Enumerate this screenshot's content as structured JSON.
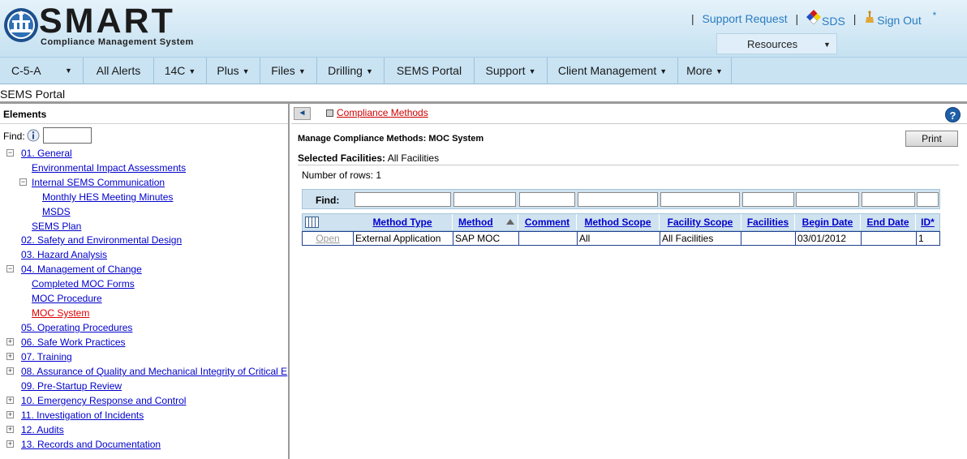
{
  "header": {
    "logo_word": "SMART",
    "logo_subtitle": "Compliance Management System",
    "top_links": {
      "sep": "|",
      "support_request": "Support Request",
      "sds": "SDS",
      "sign_out": "Sign Out",
      "star": "*"
    },
    "resources": {
      "label": "Resources",
      "arrow": "▼"
    }
  },
  "nav": {
    "items": [
      {
        "label": "C-5-A",
        "arrow": "▼"
      },
      {
        "label": "All Alerts"
      },
      {
        "label": "14C",
        "arrow": "▼"
      },
      {
        "label": "Plus",
        "arrow": "▼"
      },
      {
        "label": "Files",
        "arrow": "▼"
      },
      {
        "label": "Drilling",
        "arrow": "▼"
      },
      {
        "label": "SEMS Portal"
      },
      {
        "label": "Support",
        "arrow": "▼"
      },
      {
        "label": "Client Management",
        "arrow": "▼"
      },
      {
        "label": "More",
        "arrow": "▼"
      }
    ]
  },
  "breadcrumb": "SEMS Portal",
  "left_pane": {
    "title": "Elements",
    "find_label": "Find:",
    "find_value": "",
    "toggle_collapse": "−",
    "toggle_expand": "+",
    "tree": [
      {
        "label": "01. General",
        "expanded": true
      },
      {
        "label": "Environmental Impact Assessments"
      },
      {
        "label": "Internal SEMS Communication",
        "expanded": true
      },
      {
        "label": "Monthly HES Meeting Minutes"
      },
      {
        "label": "MSDS"
      },
      {
        "label": "SEMS Plan"
      },
      {
        "label": "02. Safety and Environmental Design"
      },
      {
        "label": "03. Hazard Analysis"
      },
      {
        "label": "04. Management of Change",
        "expanded": true
      },
      {
        "label": "Completed MOC Forms"
      },
      {
        "label": "MOC Procedure"
      },
      {
        "label": "MOC System",
        "selected": true
      },
      {
        "label": "05. Operating Procedures"
      },
      {
        "label": "06. Safe Work Practices"
      },
      {
        "label": "07. Training"
      },
      {
        "label": "08. Assurance of Quality and Mechanical Integrity of Critical E"
      },
      {
        "label": "09. Pre-Startup Review"
      },
      {
        "label": "10. Emergency Response and Control"
      },
      {
        "label": "11. Investigation of Incidents"
      },
      {
        "label": "12. Audits"
      },
      {
        "label": "13. Records and Documentation"
      }
    ]
  },
  "right_pane": {
    "back_icon": "◄",
    "title": "Compliance Methods",
    "help_icon": "?",
    "manage_title": "Manage Compliance Methods: MOC System",
    "print_label": "Print",
    "selected_facilities_label": "Selected Facilities:",
    "selected_facilities_value": "All Facilities",
    "rows_text": "Number of rows: 1",
    "find_label": "Find:",
    "columns": [
      "Method Type",
      "Method",
      "Comment",
      "Method Scope",
      "Facility Scope",
      "Facilities",
      "Begin Date",
      "End Date",
      "ID*"
    ],
    "sorted_column": "Method",
    "rows": [
      {
        "action": "Open",
        "cells": [
          "External Application",
          "SAP MOC",
          "",
          "All",
          "All Facilities",
          "",
          "03/01/2012",
          "",
          "1"
        ]
      }
    ]
  }
}
